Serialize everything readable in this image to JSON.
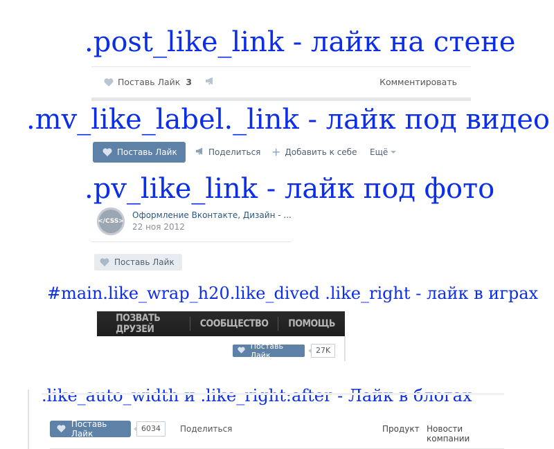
{
  "headings": {
    "h1": ".post_like_link - лайк на стене",
    "h2": ".mv_like_label._link - лайк под видео",
    "h3": ".pv_like_link - лайк под фото",
    "h4": "#main.like_wrap_h20.like_dived .like_right - лайк в играх",
    "h5": ".like_auto_width и .like_right:after - Лайк в блогах"
  },
  "wall": {
    "like_label": "Поставь Лайк",
    "like_count": "3",
    "comment_label": "Комментировать"
  },
  "video": {
    "like_label": "Поставь Лайк",
    "share_label": "Поделиться",
    "add_label": "Добавить к себе",
    "more_label": "Ещё"
  },
  "photo": {
    "avatar_text": "</CSS>",
    "author": "Оформление Вконтакте, Дизайн - ...",
    "date": "22 ноя 2012",
    "like_label": "Поставь Лайк"
  },
  "games": {
    "nav": [
      "ПОЗВАТЬ ДРУЗЕЙ",
      "СООБЩЕСТВО",
      "ПОМОЩЬ"
    ],
    "like_label": "Поставь Лайк",
    "like_count": "27K"
  },
  "blogs": {
    "like_label": "Поставь Лайк",
    "like_count": "6034",
    "share_label": "Поделиться",
    "product_label": "Продукт",
    "news_label": "Новости компании"
  },
  "colors": {
    "heading": "#0c2ee8",
    "vk_blue": "#5e81a8",
    "link": "#2a5885"
  }
}
